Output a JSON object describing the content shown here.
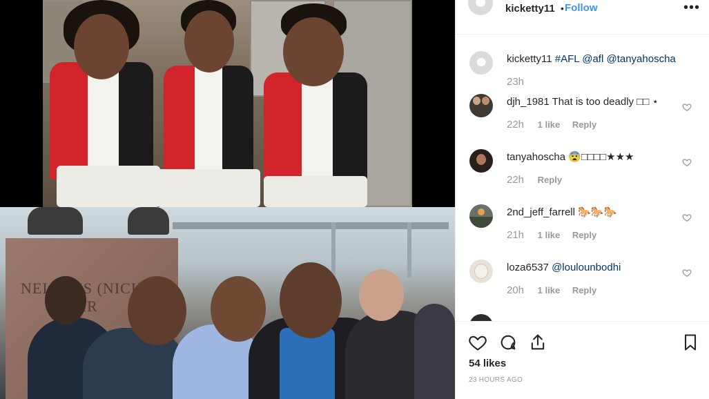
{
  "header": {
    "username": "kicketty11",
    "separator": "•",
    "follow_label": "Follow",
    "more_label": "•••"
  },
  "caption": {
    "username": "kicketty11",
    "text": "#AFL @afl @tanyahoscha",
    "time": "23h"
  },
  "comments": [
    {
      "username": "djh_1981",
      "text": "That is too deadly □□ ⋆",
      "time": "22h",
      "likes": "1 like",
      "reply": "Reply"
    },
    {
      "username": "tanyahoscha",
      "text": "😨□□□□★★★",
      "time": "22h",
      "likes": "",
      "reply": "Reply"
    },
    {
      "username": "2nd_jeff_farrell",
      "text": "🐎🐎🐎",
      "time": "21h",
      "likes": "1 like",
      "reply": "Reply"
    },
    {
      "username": "loza6537",
      "text": "@loulounbodhi",
      "time": "20h",
      "likes": "1 like",
      "reply": "Reply"
    }
  ],
  "post": {
    "likes": "54 likes",
    "timestamp": "23 HOURS AGO"
  },
  "photo": {
    "plinth_text": "NEI    VIS (NICK\n          MAR"
  },
  "colors": {
    "link_blue": "#3897f0",
    "tag_blue": "#003569",
    "muted": "#999999"
  }
}
